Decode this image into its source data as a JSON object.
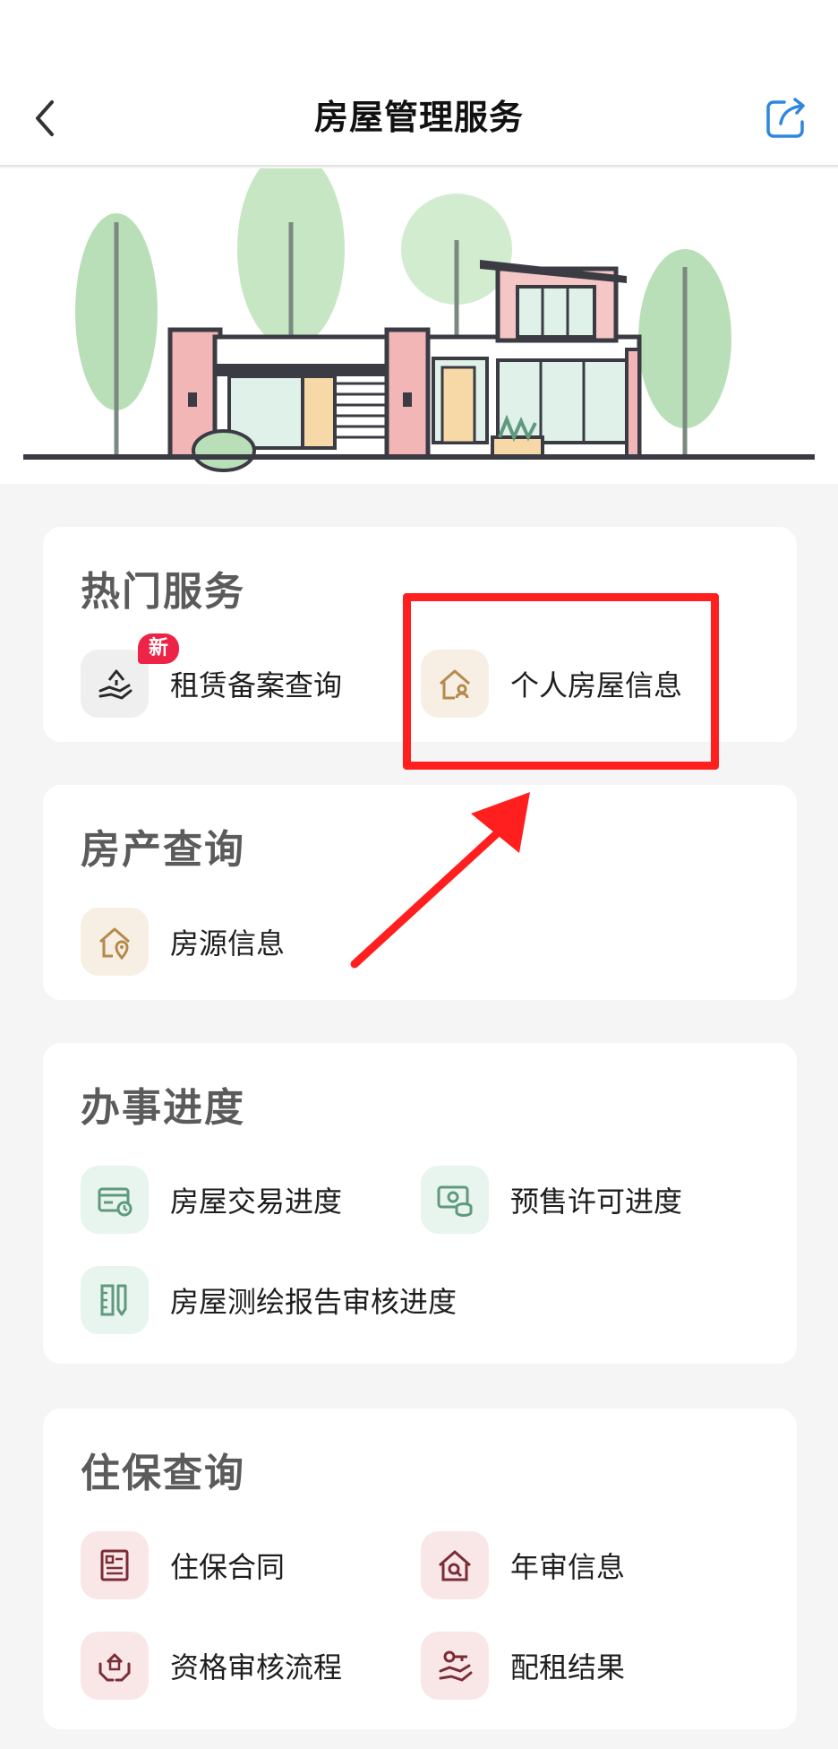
{
  "nav": {
    "title": "房屋管理服务"
  },
  "sections": {
    "hot": {
      "title": "热门服务",
      "items": [
        {
          "label": "租赁备案查询",
          "badge": "新"
        },
        {
          "label": "个人房屋信息"
        }
      ]
    },
    "property": {
      "title": "房产查询",
      "items": [
        {
          "label": "房源信息"
        }
      ]
    },
    "progress": {
      "title": "办事进度",
      "items": [
        {
          "label": "房屋交易进度"
        },
        {
          "label": "预售许可进度"
        },
        {
          "label": "房屋测绘报告审核进度"
        }
      ]
    },
    "housing": {
      "title": "住保查询",
      "items": [
        {
          "label": "住保合同"
        },
        {
          "label": "年审信息"
        },
        {
          "label": "资格审核流程"
        },
        {
          "label": "配租结果"
        }
      ]
    }
  },
  "icons": {
    "back": "chevron-left-icon",
    "share": "share-icon"
  },
  "colors": {
    "badge": "#ee2348",
    "annotation": "#ff1f1f",
    "icon_gold": "#b58a4a",
    "icon_green": "#5f9a7e",
    "icon_maroon": "#7b2c36"
  }
}
